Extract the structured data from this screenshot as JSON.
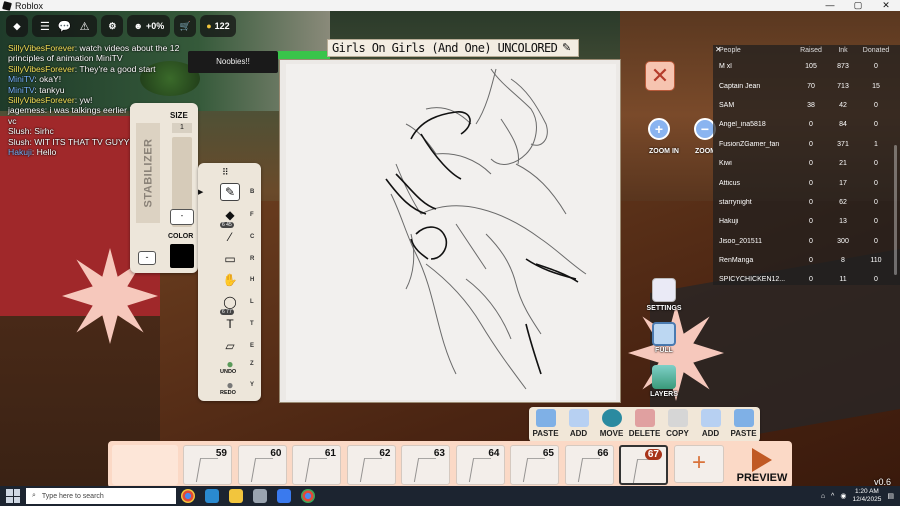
{
  "window": {
    "title": "Roblox",
    "controls": [
      "—",
      "▢",
      "✕"
    ]
  },
  "hud": {
    "coins": "+0%",
    "robux": "122"
  },
  "scene": {
    "sign": "Noobies!!"
  },
  "chat": [
    {
      "name": "SillyVibesForever",
      "msg": " watch videos about the 12 principles of animation MiniTV",
      "color": "y"
    },
    {
      "name": "SillyVibesForever",
      "msg": " They're a good start",
      "color": "y"
    },
    {
      "name": "MiniTV",
      "msg": " okaY!",
      "color": "b"
    },
    {
      "name": "MiniTV",
      "msg": " tankyu",
      "color": "b"
    },
    {
      "name": "SillyVibesForever",
      "msg": " yw!",
      "color": "y"
    },
    {
      "name": "jagemess",
      "msg": " i was talkings eerlier i thought u had vc",
      "color": "w"
    },
    {
      "name": "Slush",
      "msg": " Sirhc",
      "color": "w"
    },
    {
      "name": "Slush",
      "msg": " WIT ITS THAT TV GUYYY",
      "color": "w"
    },
    {
      "name": "Hakuji",
      "msg": " Hello",
      "color": "b"
    }
  ],
  "stabilizer": {
    "label": "STABILIZER",
    "size_label": "SIZE",
    "size_value": "1",
    "knob": "-",
    "color_label": "COLOR",
    "minus": "-"
  },
  "tools": [
    {
      "name": "brush",
      "key": "B",
      "glyph": "✎"
    },
    {
      "name": "fill",
      "key": "F",
      "glyph": "◆",
      "sub": "6 45"
    },
    {
      "name": "color-picker",
      "key": "C",
      "glyph": "⁄"
    },
    {
      "name": "shape",
      "key": "R",
      "glyph": "▭"
    },
    {
      "name": "hand",
      "key": "H",
      "glyph": "✋"
    },
    {
      "name": "lasso",
      "key": "L",
      "glyph": "◯",
      "sub": "6 77"
    },
    {
      "name": "text",
      "key": "T",
      "glyph": "T"
    },
    {
      "name": "eraser",
      "key": "E",
      "glyph": "▱"
    }
  ],
  "tools_undo": {
    "label": "UNDO",
    "key": "Z"
  },
  "tools_redo": {
    "label": "REDO",
    "key": "Y"
  },
  "canvas": {
    "title": "Girls On Girls (And One) UNCOLORED"
  },
  "zoom": {
    "in": "ZOOM IN",
    "out": "ZOOM OUT"
  },
  "side": {
    "settings": "SETTINGS",
    "full": "FULL",
    "layers": "LAYERS"
  },
  "leaderboard": {
    "headers": {
      "people": "People",
      "raised": "Raised",
      "ink": "Ink",
      "donated": "Donated"
    },
    "rows": [
      {
        "name": "M xl",
        "raised": "105",
        "ink": "873",
        "donated": "0"
      },
      {
        "name": "Captain Jean",
        "raised": "70",
        "ink": "713",
        "donated": "15"
      },
      {
        "name": "SAM",
        "raised": "38",
        "ink": "42",
        "donated": "0"
      },
      {
        "name": "Angel_ina5818",
        "raised": "0",
        "ink": "84",
        "donated": "0"
      },
      {
        "name": "FusionZGamer_fan",
        "raised": "0",
        "ink": "371",
        "donated": "1"
      },
      {
        "name": "Kiwi",
        "raised": "0",
        "ink": "21",
        "donated": "0"
      },
      {
        "name": "Atticus",
        "raised": "0",
        "ink": "17",
        "donated": "0"
      },
      {
        "name": "starrynight",
        "raised": "0",
        "ink": "62",
        "donated": "0"
      },
      {
        "name": "Hakuji",
        "raised": "0",
        "ink": "13",
        "donated": "0"
      },
      {
        "name": "Jisoo_201511",
        "raised": "0",
        "ink": "300",
        "donated": "0"
      },
      {
        "name": "RenManga",
        "raised": "0",
        "ink": "8",
        "donated": "110"
      },
      {
        "name": "SPICYCHICKEN12...",
        "raised": "0",
        "ink": "11",
        "donated": "0"
      }
    ]
  },
  "edit_bar": [
    "PASTE",
    "ADD",
    "MOVE",
    "DELETE",
    "COPY",
    "ADD",
    "PASTE"
  ],
  "frames": [
    "59",
    "60",
    "61",
    "62",
    "63",
    "64",
    "65",
    "66",
    "67"
  ],
  "add_frame": "+",
  "preview": "PREVIEW",
  "version": "v0.6",
  "taskbar": {
    "search": "Type here to search",
    "time": "1:20 AM",
    "date": "12/4/2025"
  },
  "colors": {
    "accent": "#c05a25",
    "timeline": "#fbd9c6",
    "panel": "#ede6da",
    "burst": "#f6c8bc"
  }
}
